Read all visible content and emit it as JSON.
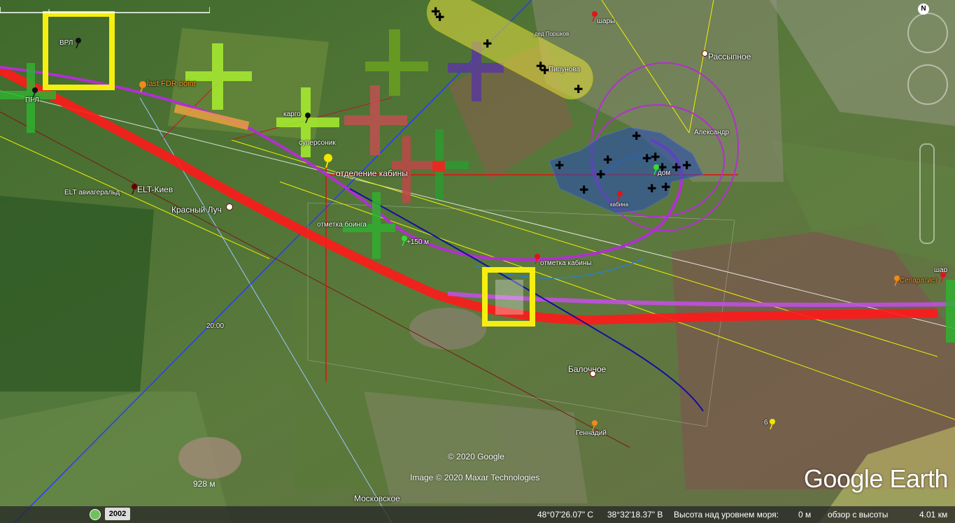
{
  "map": {
    "labels": {
      "vrl": "ВРЛ",
      "prl": "ПРЛ",
      "last_fdr": "last FDR point",
      "cargo": "карго",
      "supersonik": "суперсоник",
      "cabin_sep": "отделение кабины",
      "elt_kiev": "ELT-Киев",
      "elt_avia": "ELT авиагеральд",
      "krasny_luch": "Красный Луч",
      "boeing_mark": "отметка боинга",
      "plus150": "+150 м",
      "cabin_mark": "отметка кабины",
      "cabin": "кабина",
      "dom": "дом",
      "ded_porshkov": "дед Поршков",
      "shary": "шары",
      "pipunova": "Пипунова",
      "rassypnoe": "Рассыпное",
      "aleksandr": "Александр",
      "separatist": "Сепаратист",
      "shar": "шар",
      "time2000": "20:00",
      "balochnoe": "Балочное",
      "gennady": "Геннадий",
      "six": "6",
      "moskovskoe": "Московское"
    },
    "credits": {
      "google": "© 2020 Google",
      "maxar": "Image © 2020 Maxar Technologies"
    },
    "logo": "Google Earth",
    "compass_letter": "N",
    "scale_label": "928 м"
  },
  "statusbar": {
    "year": "2002",
    "lat": "48°07'26.07\" С",
    "lon": "38°32'18.37\" В",
    "elev_label": "Высота над уровнем моря:",
    "elev_value": "0 м",
    "eye_label": "обзор с высоты",
    "eye_value": "4.01 км"
  },
  "colors": {
    "track_red": "#ff1a1a",
    "track_purple": "#b030d0",
    "yellow_box": "#f5ee10",
    "green_cross": "#9be024",
    "blue_zone": "#2a4fb0",
    "pin_red": "#e0141a",
    "pin_orange": "#f08a18",
    "pin_yellow": "#f2e600"
  }
}
